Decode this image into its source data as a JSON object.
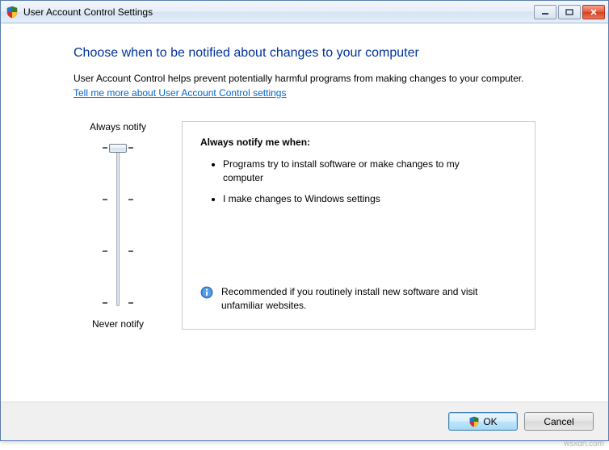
{
  "window": {
    "title": "User Account Control Settings"
  },
  "content": {
    "heading": "Choose when to be notified about changes to your computer",
    "description": "User Account Control helps prevent potentially harmful programs from making changes to your computer.",
    "link_text": "Tell me more about User Account Control settings"
  },
  "slider": {
    "top_label": "Always notify",
    "bottom_label": "Never notify",
    "levels": 4,
    "current_level": 0
  },
  "panel": {
    "title": "Always notify me when:",
    "bullets": [
      "Programs try to install software or make changes to my computer",
      "I make changes to Windows settings"
    ],
    "recommendation": "Recommended if you routinely install new software and visit unfamiliar websites."
  },
  "buttons": {
    "ok": "OK",
    "cancel": "Cancel"
  },
  "watermark": "wsxdn.com"
}
